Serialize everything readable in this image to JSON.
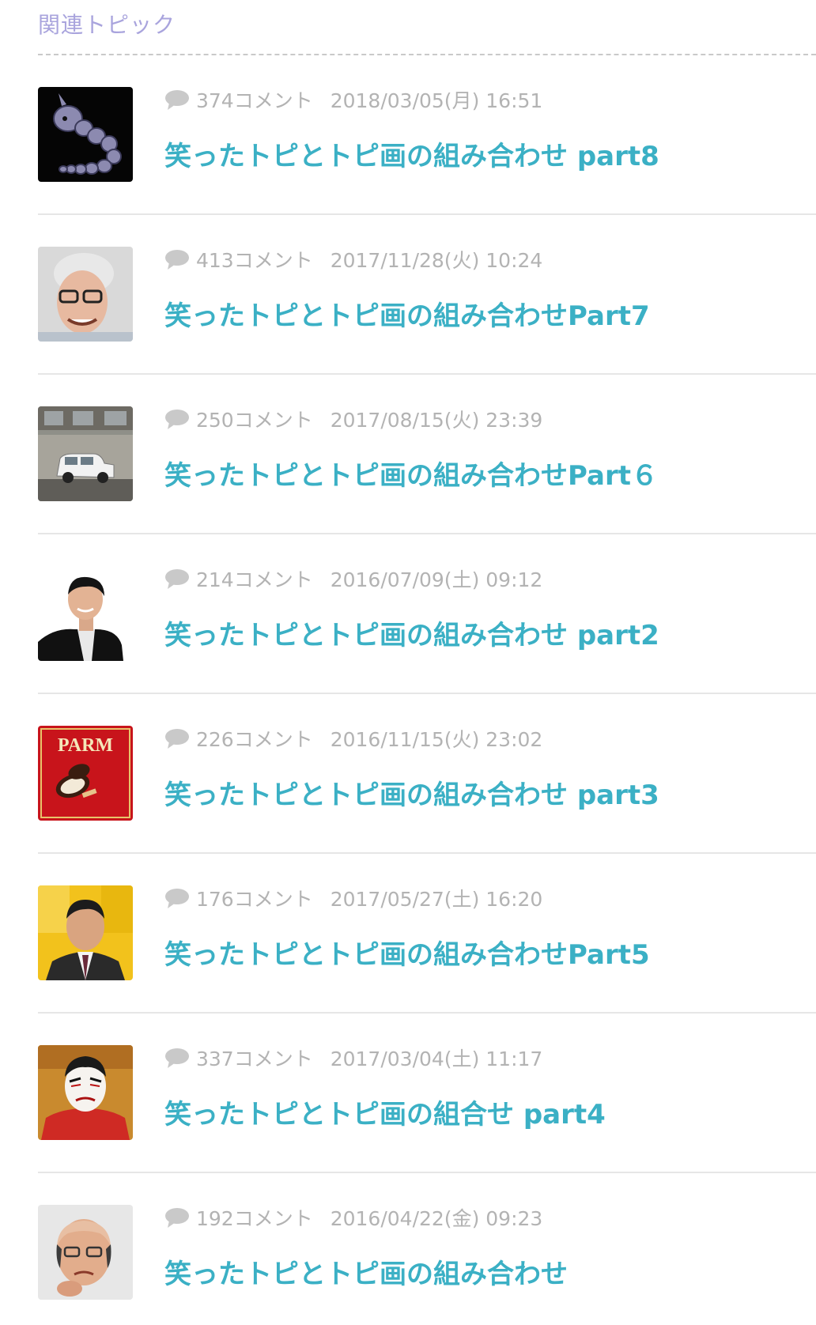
{
  "section": {
    "title": "関連トピック"
  },
  "colors": {
    "title": "#a9a4dd",
    "link": "#3bb0c5",
    "meta": "#b3b3b3"
  },
  "topics": [
    {
      "comments": "374コメント",
      "date": "2018/03/05(月) 16:51",
      "title": "笑ったトピとトピ画の組み合わせ part8",
      "thumb": "onix-pokemon"
    },
    {
      "comments": "413コメント",
      "date": "2017/11/28(火) 10:24",
      "title": "笑ったトピとトピ画の組み合わせPart7",
      "thumb": "smiling-man-glasses"
    },
    {
      "comments": "250コメント",
      "date": "2017/08/15(火) 23:39",
      "title": "笑ったトピとトピ画の組み合わせPart６",
      "thumb": "white-car-street"
    },
    {
      "comments": "214コメント",
      "date": "2016/07/09(土) 09:12",
      "title": "笑ったトピとトピ画の組み合わせ part2",
      "thumb": "man-black-jacket"
    },
    {
      "comments": "226コメント",
      "date": "2016/11/15(火) 23:02",
      "title": "笑ったトピとトピ画の組み合わせ part3",
      "thumb": "parm-ice-cream-box",
      "thumb_text": "PARM"
    },
    {
      "comments": "176コメント",
      "date": "2017/05/27(土) 16:20",
      "title": "笑ったトピとトピ画の組み合わせPart5",
      "thumb": "man-in-suit-yellow-bg"
    },
    {
      "comments": "337コメント",
      "date": "2017/03/04(土) 11:17",
      "title": "笑ったトピとトピ画の組合せ part4",
      "thumb": "kabuki-actor"
    },
    {
      "comments": "192コメント",
      "date": "2016/04/22(金) 09:23",
      "title": "笑ったトピとトピ画の組み合わせ",
      "thumb": "bald-man-glasses"
    }
  ]
}
